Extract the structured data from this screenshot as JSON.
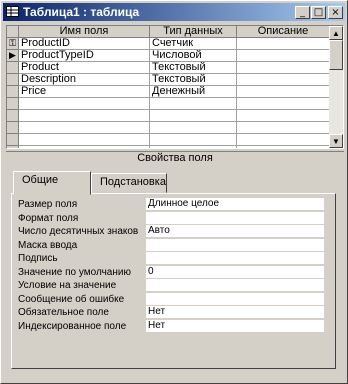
{
  "window": {
    "title": "Таблица1 : таблица"
  },
  "title_buttons": {
    "minimize": "_",
    "maximize": "□",
    "close": "×"
  },
  "grid": {
    "columns": [
      "Имя поля",
      "Тип данных",
      "Описание"
    ],
    "rows": [
      {
        "selector": "⚿",
        "name": "ProductID",
        "type": "Счетчик",
        "desc": ""
      },
      {
        "selector": "▶",
        "name": "ProductTypeID",
        "type": "Числовой",
        "desc": ""
      },
      {
        "selector": "",
        "name": "Product",
        "type": "Текстовый",
        "desc": ""
      },
      {
        "selector": "",
        "name": "Description",
        "type": "Текстовый",
        "desc": ""
      },
      {
        "selector": "",
        "name": "Price",
        "type": "Денежный",
        "desc": ""
      },
      {
        "selector": "",
        "name": "",
        "type": "",
        "desc": ""
      },
      {
        "selector": "",
        "name": "",
        "type": "",
        "desc": ""
      },
      {
        "selector": "",
        "name": "",
        "type": "",
        "desc": ""
      },
      {
        "selector": "",
        "name": "",
        "type": "",
        "desc": ""
      },
      {
        "selector": "",
        "name": "",
        "type": "",
        "desc": ""
      }
    ]
  },
  "properties": {
    "title": "Свойства поля",
    "tabs": [
      "Общие",
      "Подстановка"
    ],
    "rows": [
      {
        "label": "Размер поля",
        "value": "Длинное целое"
      },
      {
        "label": "Формат поля",
        "value": ""
      },
      {
        "label": "Число десятичных знаков",
        "value": "Авто"
      },
      {
        "label": "Маска ввода",
        "value": ""
      },
      {
        "label": "Подпись",
        "value": ""
      },
      {
        "label": "Значение по умолчанию",
        "value": "0"
      },
      {
        "label": "Условие на значение",
        "value": ""
      },
      {
        "label": "Сообщение об ошибке",
        "value": ""
      },
      {
        "label": "Обязательное поле",
        "value": "Нет"
      },
      {
        "label": "Индексированное поле",
        "value": "Нет"
      }
    ]
  }
}
